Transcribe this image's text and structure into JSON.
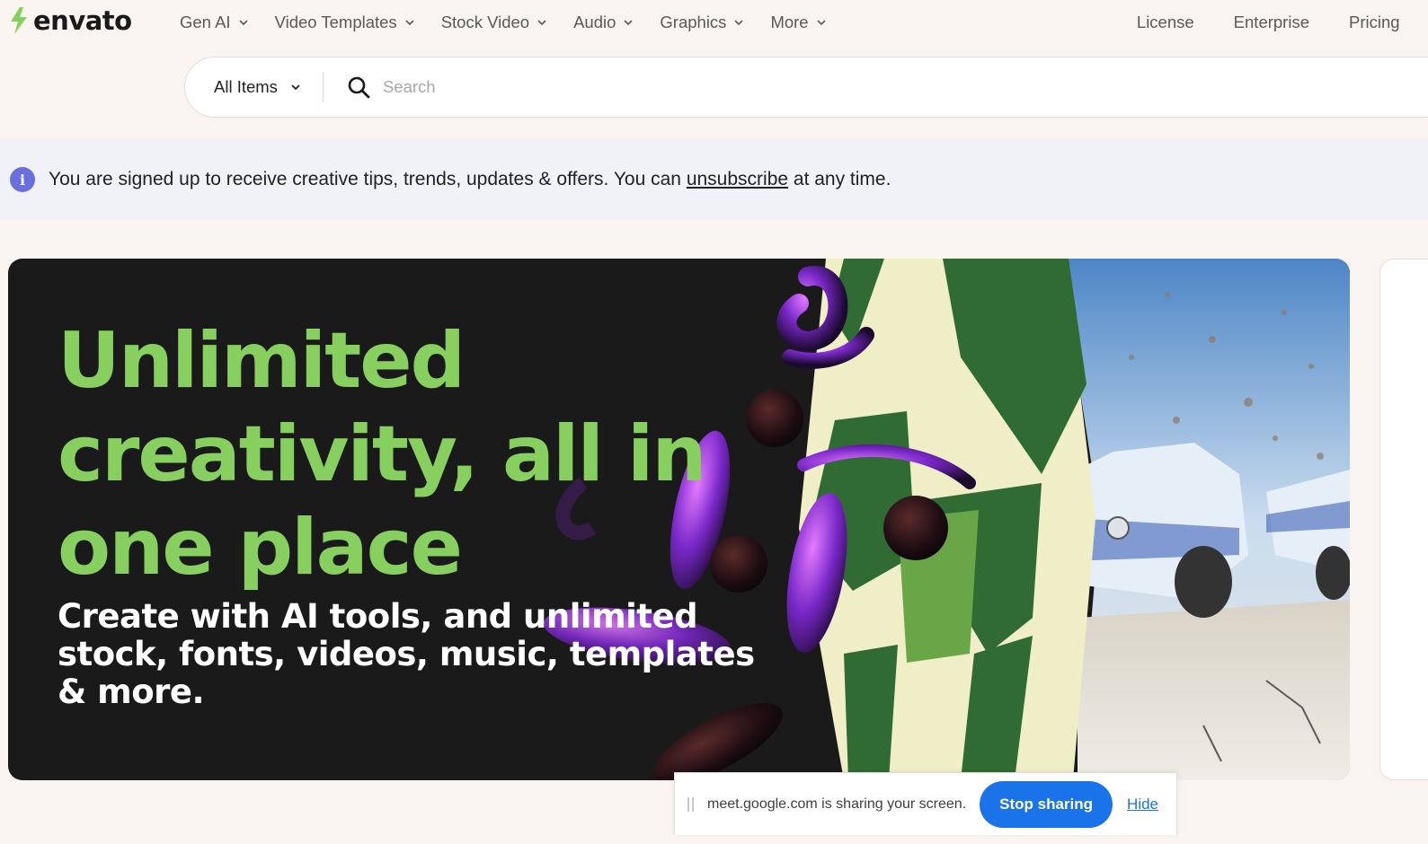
{
  "brand": {
    "name": "envato",
    "accent": "#87cf5e"
  },
  "nav": {
    "items": [
      {
        "label": "Gen AI"
      },
      {
        "label": "Video Templates"
      },
      {
        "label": "Stock Video"
      },
      {
        "label": "Audio"
      },
      {
        "label": "Graphics"
      },
      {
        "label": "More"
      }
    ],
    "right_links": [
      {
        "label": "License"
      },
      {
        "label": "Enterprise"
      },
      {
        "label": "Pricing"
      }
    ]
  },
  "search": {
    "category": "All Items",
    "placeholder": "Search",
    "value": ""
  },
  "notice": {
    "text_before": "You are signed up to receive creative tips, trends, updates & offers. You can",
    "link": "unsubscribe",
    "text_after": "at any time.",
    "icon_color": "#6a6fe0"
  },
  "hero": {
    "title": "Unlimited creativity, all in one place",
    "subtitle": "Create with AI tools, and unlimited stock, fonts, videos, music, templates & more.",
    "title_color": "#87cf5e"
  },
  "screen_share": {
    "message": "meet.google.com is sharing your screen.",
    "stop_label": "Stop sharing",
    "hide_label": "Hide",
    "button_color": "#1a73e8"
  }
}
